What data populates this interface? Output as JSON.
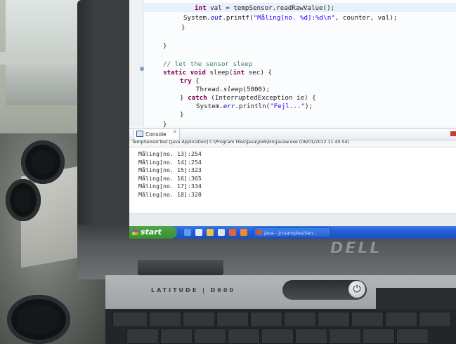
{
  "editor": {
    "code_lines": [
      {
        "parts": [
          {
            "t": "int",
            "c": "kw"
          },
          {
            "t": " val = tempSensor.readRawValue();",
            "c": ""
          }
        ]
      },
      {
        "parts": [
          {
            "t": "System.",
            "c": ""
          },
          {
            "t": "out",
            "c": "fld"
          },
          {
            "t": ".printf(",
            "c": ""
          },
          {
            "t": "\"Måling[no. %d]:%d\\n\"",
            "c": "str"
          },
          {
            "t": ", counter, val);",
            "c": ""
          }
        ]
      },
      {
        "parts": [
          {
            "t": "}",
            "c": ""
          }
        ]
      },
      {
        "parts": [
          {
            "t": "}",
            "c": ""
          }
        ]
      },
      {
        "parts": [
          {
            "t": "// let the sensor sleep",
            "c": "cmt"
          }
        ]
      },
      {
        "parts": [
          {
            "t": "static void",
            "c": "kw"
          },
          {
            "t": " sleep(",
            "c": ""
          },
          {
            "t": "int",
            "c": "kw"
          },
          {
            "t": " sec) {",
            "c": ""
          }
        ]
      },
      {
        "parts": [
          {
            "t": "try",
            "c": "kw"
          },
          {
            "t": " {",
            "c": ""
          }
        ]
      },
      {
        "parts": [
          {
            "t": "Thread.",
            "c": ""
          },
          {
            "t": "sleep",
            "c": "mth-i"
          },
          {
            "t": "(5000);",
            "c": ""
          }
        ]
      },
      {
        "parts": [
          {
            "t": "} ",
            "c": ""
          },
          {
            "t": "catch",
            "c": "kw"
          },
          {
            "t": " (InterruptedException ie) {",
            "c": ""
          }
        ]
      },
      {
        "parts": [
          {
            "t": "System.",
            "c": ""
          },
          {
            "t": "err",
            "c": "fld"
          },
          {
            "t": ".println(",
            "c": ""
          },
          {
            "t": "\"Fejl...\"",
            "c": "str"
          },
          {
            "t": ");",
            "c": ""
          }
        ]
      },
      {
        "parts": [
          {
            "t": "}",
            "c": ""
          }
        ]
      },
      {
        "parts": [
          {
            "t": "}",
            "c": ""
          }
        ]
      }
    ]
  },
  "console": {
    "tab_label": "Console",
    "header": "TempSensorTest [Java Application] C:\\Program Files\\Java\\jre6\\bin\\javaw.exe (06/01/2012 11.40.54)",
    "lines": [
      "Måling[no. 13]:254",
      "Måling[no. 14]:254",
      "Måling[no. 15]:323",
      "Måling[no. 16]:365",
      "Måling[no. 17]:334",
      "Måling[no. 18]:328"
    ]
  },
  "taskbar": {
    "start_label": "start",
    "task_label": "Java - jrcsamples/Sen..."
  },
  "laptop": {
    "brand": "DELL",
    "model": "LATITUDE | D600"
  }
}
